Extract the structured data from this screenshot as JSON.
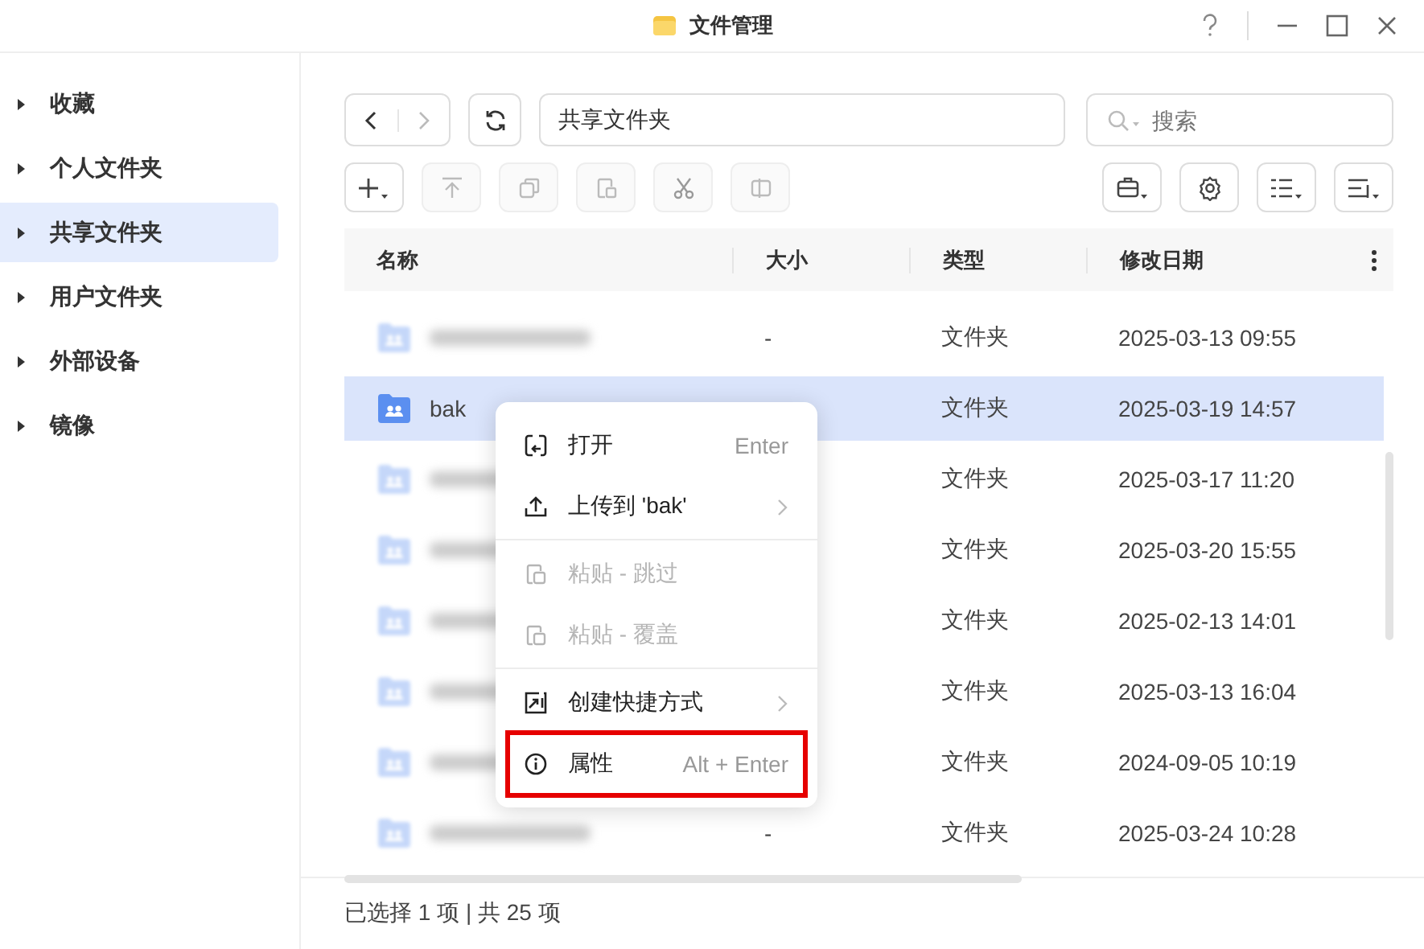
{
  "window": {
    "title": "文件管理"
  },
  "sidebar": {
    "items": [
      {
        "label": "收藏",
        "selected": false
      },
      {
        "label": "个人文件夹",
        "selected": false
      },
      {
        "label": "共享文件夹",
        "selected": true
      },
      {
        "label": "用户文件夹",
        "selected": false
      },
      {
        "label": "外部设备",
        "selected": false
      },
      {
        "label": "镜像",
        "selected": false
      }
    ]
  },
  "path": {
    "value": "共享文件夹"
  },
  "search": {
    "placeholder": "搜索"
  },
  "table": {
    "columns": [
      "名称",
      "大小",
      "类型",
      "修改日期"
    ],
    "rows": [
      {
        "name": "",
        "blurred": true,
        "size": "-",
        "type": "文件夹",
        "modified": "2025-03-13 09:55",
        "selected": false
      },
      {
        "name": "bak",
        "blurred": false,
        "size": "",
        "type": "文件夹",
        "modified": "2025-03-19 14:57",
        "selected": true
      },
      {
        "name": "",
        "blurred": true,
        "size": "",
        "type": "文件夹",
        "modified": "2025-03-17 11:20",
        "selected": false
      },
      {
        "name": "",
        "blurred": true,
        "size": "",
        "type": "文件夹",
        "modified": "2025-03-20 15:55",
        "selected": false
      },
      {
        "name": "",
        "blurred": true,
        "size": "",
        "type": "文件夹",
        "modified": "2025-02-13 14:01",
        "selected": false
      },
      {
        "name": "",
        "blurred": true,
        "size": "",
        "type": "文件夹",
        "modified": "2025-03-13 16:04",
        "selected": false
      },
      {
        "name": "",
        "blurred": true,
        "size": "",
        "type": "文件夹",
        "modified": "2024-09-05 10:19",
        "selected": false
      },
      {
        "name": "",
        "blurred": true,
        "size": "-",
        "type": "文件夹",
        "modified": "2025-03-24 10:28",
        "selected": false
      }
    ]
  },
  "context_menu": {
    "items": [
      {
        "kind": "item",
        "label": "打开",
        "shortcut": "Enter",
        "disabled": false,
        "submenu": false,
        "outlined": false
      },
      {
        "kind": "item",
        "label": "上传到 'bak'",
        "disabled": false,
        "submenu": true,
        "outlined": false
      },
      {
        "kind": "separator"
      },
      {
        "kind": "item",
        "label": "粘贴 - 跳过",
        "disabled": true,
        "submenu": false,
        "outlined": false
      },
      {
        "kind": "item",
        "label": "粘贴 - 覆盖",
        "disabled": true,
        "submenu": false,
        "outlined": false
      },
      {
        "kind": "separator"
      },
      {
        "kind": "item",
        "label": "创建快捷方式",
        "disabled": false,
        "submenu": true,
        "outlined": false
      },
      {
        "kind": "item",
        "label": "属性",
        "shortcut": "Alt + Enter",
        "disabled": false,
        "submenu": false,
        "outlined": true
      }
    ]
  },
  "status_bar": {
    "text": "已选择 1 项 | 共 25 项"
  }
}
